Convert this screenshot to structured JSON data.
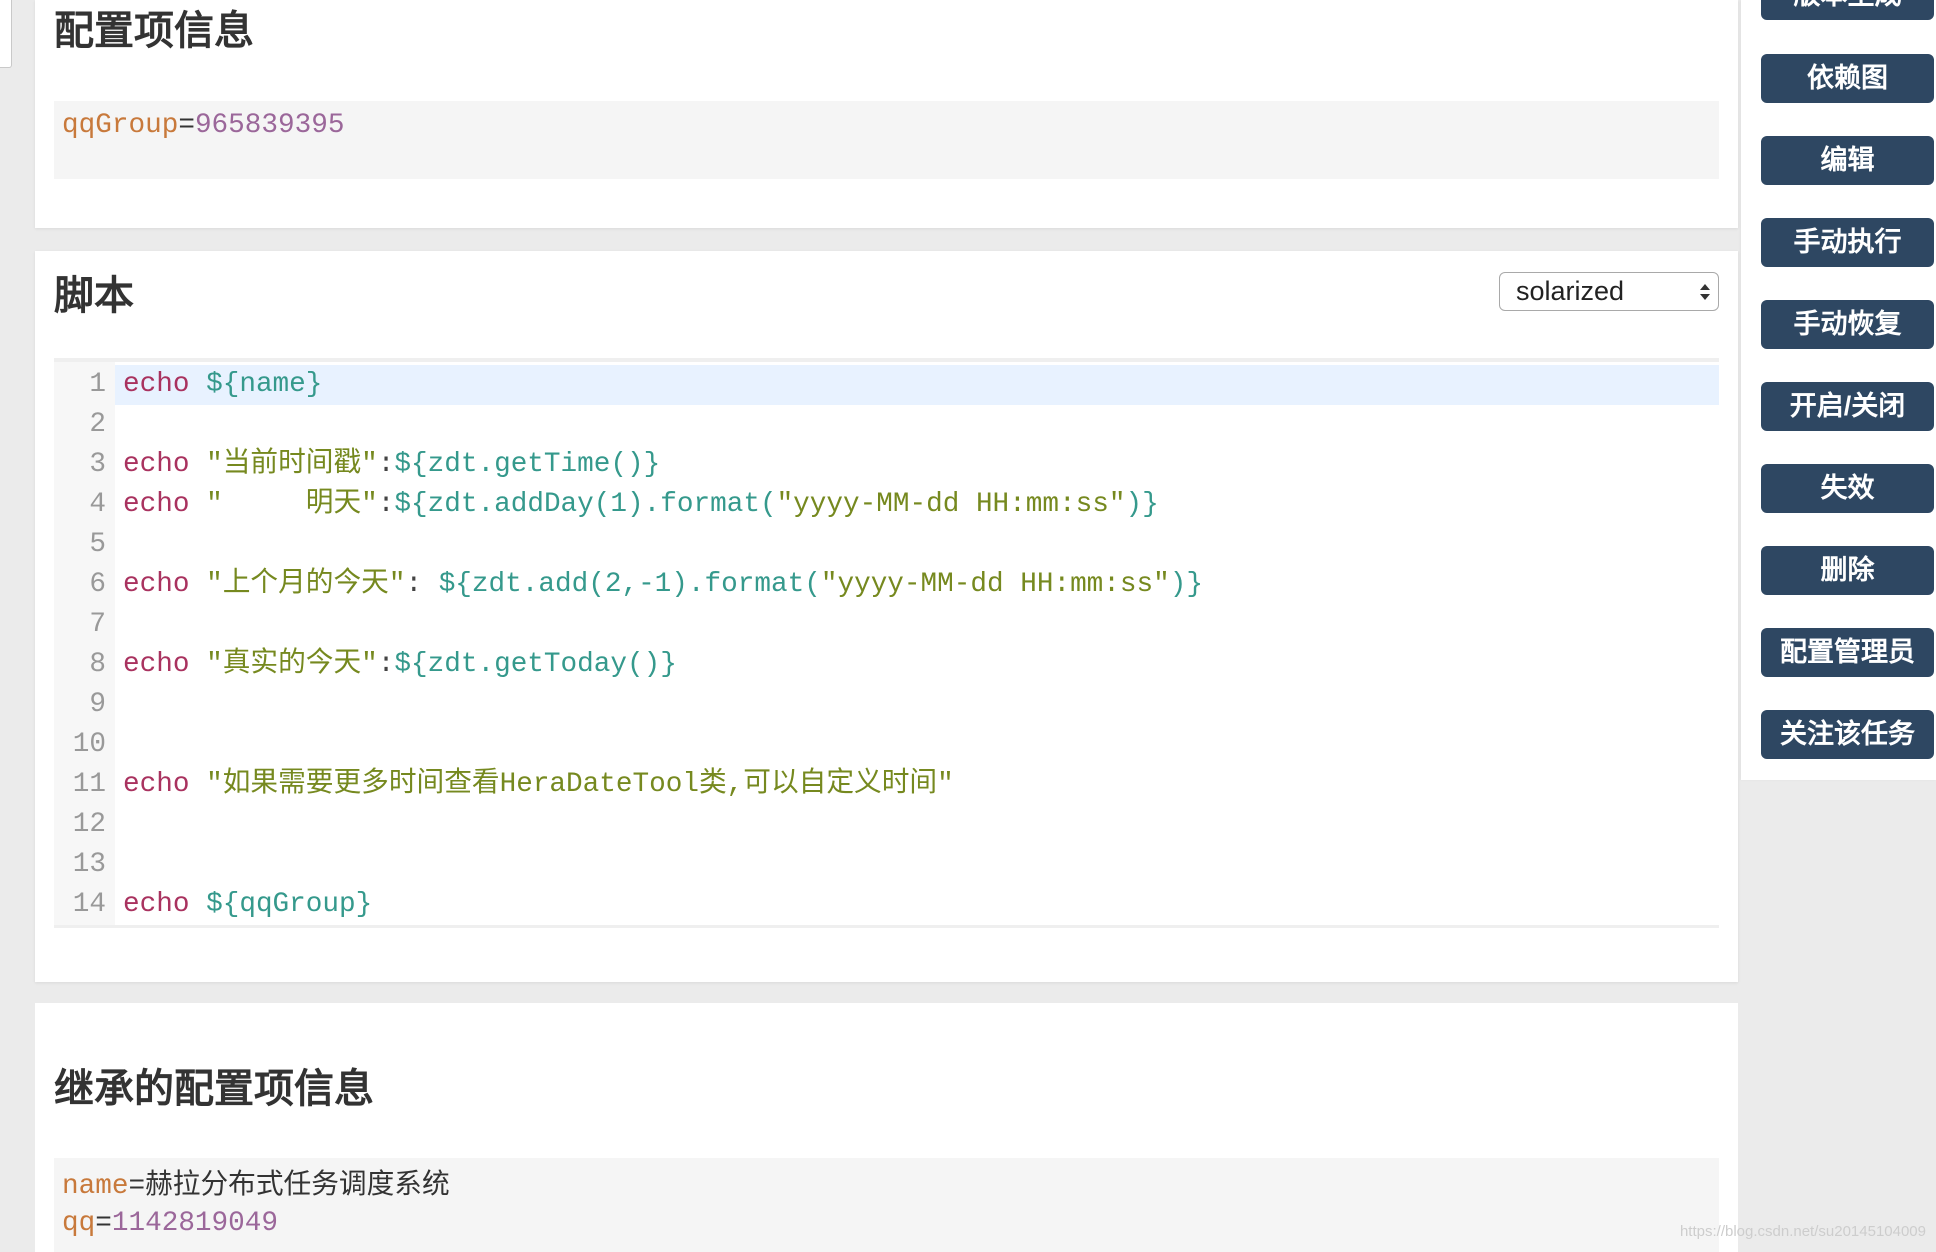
{
  "sections": {
    "config": {
      "title": "配置项信息",
      "lines": [
        {
          "key": "qqGroup",
          "eq": "=",
          "number": "965839395"
        }
      ]
    },
    "script": {
      "title": "脚本",
      "theme": {
        "selected": "solarized"
      },
      "active_line": 1,
      "lines": [
        {
          "num": "1",
          "tokens": [
            {
              "keyword": "echo"
            },
            {
              "plain": " "
            },
            {
              "variable": "${name}"
            }
          ]
        },
        {
          "num": "2",
          "tokens": []
        },
        {
          "num": "3",
          "tokens": [
            {
              "keyword": "echo"
            },
            {
              "plain": " "
            },
            {
              "string": "\"当前时间戳\""
            },
            {
              "plain": ":"
            },
            {
              "variable": "${zdt.getTime()}"
            }
          ]
        },
        {
          "num": "4",
          "tokens": [
            {
              "keyword": "echo"
            },
            {
              "plain": " "
            },
            {
              "string": "\"     明天\""
            },
            {
              "plain": ":"
            },
            {
              "variable": "${zdt.addDay(1).format("
            },
            {
              "string": "\"yyyy-MM-dd HH:mm:ss\""
            },
            {
              "variable": ")}"
            }
          ]
        },
        {
          "num": "5",
          "tokens": []
        },
        {
          "num": "6",
          "tokens": [
            {
              "keyword": "echo"
            },
            {
              "plain": " "
            },
            {
              "string": "\"上个月的今天\""
            },
            {
              "plain": ": "
            },
            {
              "variable": "${zdt.add(2,-1).format("
            },
            {
              "string": "\"yyyy-MM-dd HH:mm:ss\""
            },
            {
              "variable": ")}"
            }
          ]
        },
        {
          "num": "7",
          "tokens": []
        },
        {
          "num": "8",
          "tokens": [
            {
              "keyword": "echo"
            },
            {
              "plain": " "
            },
            {
              "string": "\"真实的今天\""
            },
            {
              "plain": ":"
            },
            {
              "variable": "${zdt.getToday()}"
            }
          ]
        },
        {
          "num": "9",
          "tokens": []
        },
        {
          "num": "10",
          "tokens": []
        },
        {
          "num": "11",
          "tokens": [
            {
              "keyword": "echo"
            },
            {
              "plain": " "
            },
            {
              "string": "\"如果需要更多时间查看HeraDateTool类,可以自定义时间\""
            }
          ]
        },
        {
          "num": "12",
          "tokens": []
        },
        {
          "num": "13",
          "tokens": []
        },
        {
          "num": "14",
          "tokens": [
            {
              "keyword": "echo"
            },
            {
              "plain": " "
            },
            {
              "variable": "${qqGroup}"
            }
          ]
        }
      ]
    },
    "inherited": {
      "title": "继承的配置项信息",
      "lines": [
        {
          "key": "name",
          "eq": "=",
          "text": "赫拉分布式任务调度系统"
        },
        {
          "key": "qq",
          "eq": "=",
          "number": "1142819049"
        }
      ]
    }
  },
  "sidebar": {
    "buttons": [
      {
        "label": "版本生成"
      },
      {
        "label": "依赖图"
      },
      {
        "label": "编辑"
      },
      {
        "label": "手动执行"
      },
      {
        "label": "手动恢复"
      },
      {
        "label": "开启/关闭"
      },
      {
        "label": "失效"
      },
      {
        "label": "删除"
      },
      {
        "label": "配置管理员"
      },
      {
        "label": "关注该任务"
      }
    ]
  },
  "watermark": "https://blog.csdn.net/su20145104009",
  "colors": {
    "page_bg": "#ebebeb",
    "card_bg": "#ffffff",
    "code_bg": "#f5f5f5",
    "title_text": "#333333",
    "keyword": "#a9325f",
    "string": "#76891f",
    "variable": "#35998c",
    "plain": "#444444",
    "line_number": "#999999",
    "active_line": "#e8f2ff",
    "prop_key": "#c8793b",
    "prop_number": "#9b679a",
    "prop_text": "#333333",
    "button_bg": "#2e4762",
    "button_text": "#ffffff"
  }
}
